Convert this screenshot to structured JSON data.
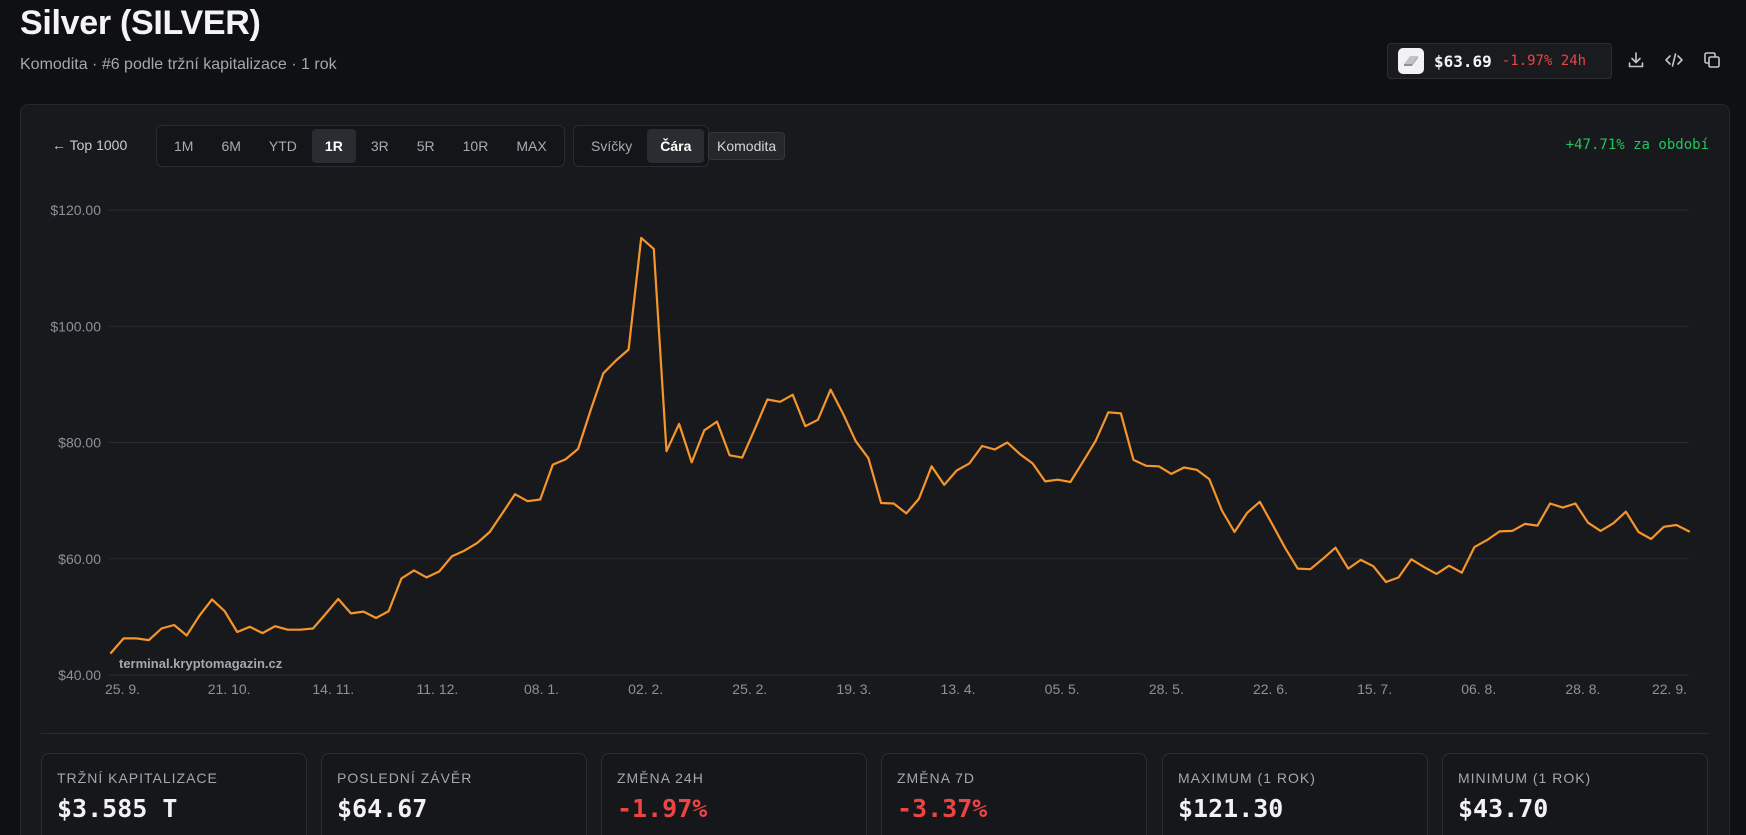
{
  "header": {
    "title": "Silver (SILVER)",
    "subtitle": "Komodita · #6 podle tržní kapitalizace · 1 rok"
  },
  "price_chip": {
    "price": "$63.69",
    "change": "-1.97% 24h",
    "logo_icon": "silver-bar-icon"
  },
  "actions": {
    "icons": [
      "download-icon",
      "code-icon",
      "copy-icon"
    ]
  },
  "toolbar": {
    "back_label": "← Top 1000",
    "ranges": [
      "1M",
      "6M",
      "YTD",
      "1R",
      "3R",
      "5R",
      "10R",
      "MAX"
    ],
    "active_range": "1R",
    "chart_types": [
      "Svíčky",
      "Čára"
    ],
    "active_chart_type": "Čára",
    "category_tag": "Komodita",
    "period_change": "+47.71% za období"
  },
  "chart_data": {
    "type": "line",
    "watermark": "terminal.kryptomagazin.cz",
    "ylim": [
      40,
      120
    ],
    "y_ticks": [
      40,
      60,
      80,
      100,
      120
    ],
    "y_tick_labels": [
      "$40.00",
      "$60.00",
      "$80.00",
      "$100.00",
      "$120.00"
    ],
    "x_tick_labels": [
      "25. 9.",
      "21. 10.",
      "14. 11.",
      "11. 12.",
      "08. 1.",
      "02. 2.",
      "25. 2.",
      "19. 3.",
      "13. 4.",
      "05. 5.",
      "28. 5.",
      "22. 6.",
      "15. 7.",
      "06. 8.",
      "28. 8.",
      "22. 9."
    ],
    "line_color": "#f5952b",
    "grid": true,
    "series": [
      {
        "values": [
          43.8,
          46.3,
          46.3,
          46.0,
          48.0,
          48.6,
          46.8,
          50.2,
          53.0,
          51.0,
          47.4,
          48.3,
          47.2,
          48.4,
          47.8,
          47.8,
          48.0,
          50.5,
          53.1,
          50.6,
          50.9,
          49.8,
          51.0,
          56.6,
          58.0,
          56.8,
          57.8,
          60.4,
          61.4,
          62.7,
          64.6,
          67.8,
          71.1,
          69.9,
          70.2,
          76.2,
          77.1,
          78.9,
          85.6,
          91.9,
          94.1,
          96.0,
          115.2,
          113.3,
          78.5,
          83.2,
          76.6,
          82.1,
          83.6,
          77.8,
          77.4,
          82.3,
          87.4,
          87.0,
          88.2,
          82.8,
          83.9,
          89.1,
          84.9,
          80.2,
          77.3,
          69.6,
          69.5,
          67.8,
          70.3,
          75.9,
          72.7,
          75.2,
          76.4,
          79.4,
          78.8,
          80.0,
          78.0,
          76.4,
          73.3,
          73.6,
          73.2,
          76.7,
          80.3,
          85.2,
          85.0,
          77.0,
          76.0,
          75.9,
          74.6,
          75.7,
          75.3,
          73.7,
          68.3,
          64.6,
          67.9,
          69.8,
          65.9,
          61.9,
          58.3,
          58.2,
          60.0,
          61.9,
          58.3,
          59.8,
          58.7,
          56.0,
          56.8,
          59.9,
          58.6,
          57.4,
          58.8,
          57.6,
          62.0,
          63.2,
          64.7,
          64.8,
          66.0,
          65.7,
          69.5,
          68.8,
          69.5,
          66.2,
          64.8,
          66.1,
          68.1,
          64.6,
          63.4,
          65.5,
          65.8,
          64.7
        ]
      }
    ]
  },
  "stats": [
    {
      "label": "Tržní kapitalizace",
      "value": "$3.585 T",
      "negative": false
    },
    {
      "label": "Poslední závěr",
      "value": "$64.67",
      "negative": false
    },
    {
      "label": "Změna 24h",
      "value": "-1.97%",
      "negative": true
    },
    {
      "label": "Změna 7D",
      "value": "-3.37%",
      "negative": true
    },
    {
      "label": "Maximum (1 rok)",
      "value": "$121.30",
      "negative": false
    },
    {
      "label": "Minimum (1 rok)",
      "value": "$43.70",
      "negative": false
    }
  ]
}
